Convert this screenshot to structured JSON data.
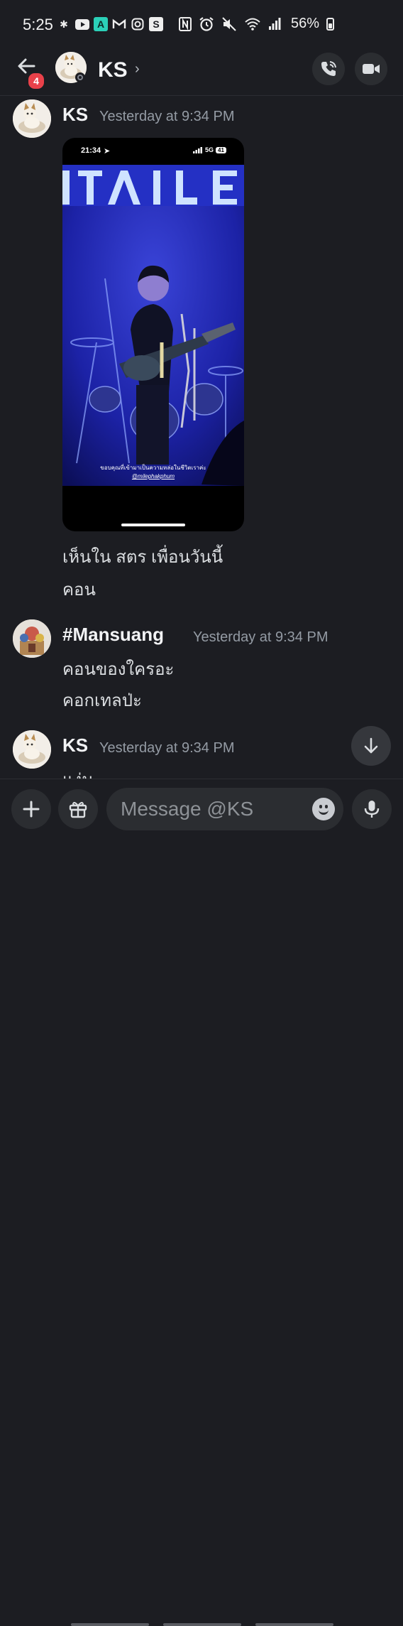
{
  "status_bar": {
    "time": "5:25",
    "battery": "56%",
    "battery_level": 0.56,
    "left_icons": [
      "slack-icon",
      "youtube-icon",
      "app-a-icon",
      "gmail-icon",
      "instagram-icon",
      "app-s-icon"
    ],
    "right_icons": [
      "nfc-icon",
      "alarm-icon",
      "mute-icon",
      "wifi-icon",
      "signal-icon",
      "battery-icon"
    ]
  },
  "header": {
    "back_badge": "4",
    "name": "KS",
    "chevron": "›"
  },
  "messages": [
    {
      "author": "KS",
      "time": "Yesterday at 9:34 PM",
      "attachment": {
        "phone_time": "21:34",
        "network": "5G",
        "battery": "41",
        "banner_text": "TAIL",
        "caption": "ขอบคุณที่เข้ามาเป็นความหล่อในชีวิตเราค่ะ",
        "handle": "@milephakphum"
      },
      "lines": [
        "เห็นใน สตร เพื่อนวันนี้",
        "คอน"
      ]
    },
    {
      "author": "#Mansuang",
      "time": "Yesterday at 9:34 PM",
      "lines": [
        "คอนของใครอะ",
        "คอกเทลป่ะ"
      ]
    },
    {
      "author": "KS",
      "time": "Yesterday at 9:34 PM",
      "lines": [
        "แง่ม"
      ]
    }
  ],
  "composer": {
    "placeholder": "Message @KS"
  },
  "colors": {
    "background": "#1c1d22",
    "badge": "#e9414a",
    "muted_text": "#949ba4"
  }
}
